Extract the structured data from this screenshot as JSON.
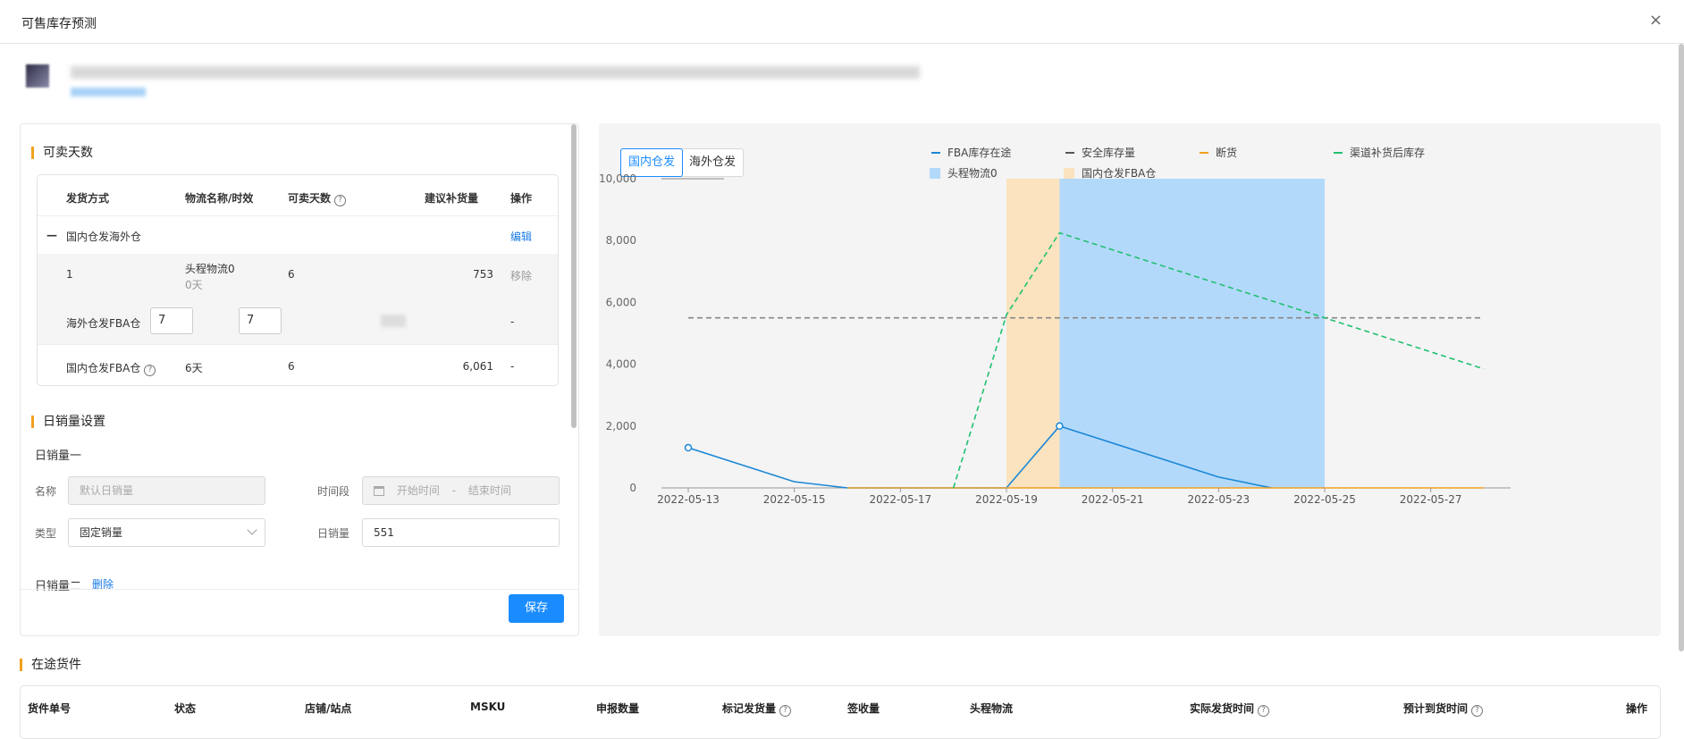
{
  "dialog": {
    "title": "可售库存预测",
    "close_icon": "×"
  },
  "left": {
    "section1_title": "可卖天数",
    "table": {
      "headers": [
        "发货方式",
        "物流名称/时效",
        "可卖天数",
        "建议补货量",
        "操作"
      ],
      "group_label": "国内仓发海外仓",
      "group_action": "编辑",
      "row1": {
        "index": "1",
        "logistics": "头程物流0",
        "logistics_time": "0天",
        "days": "6",
        "qty": "753",
        "action": "移除"
      },
      "row2": {
        "label": "海外仓发FBA仓",
        "input1": "7",
        "input2": "7",
        "action": "-"
      },
      "row3": {
        "label": "国内仓发FBA仓",
        "logistics": "6天",
        "days": "6",
        "qty": "6,061",
        "action": "-"
      }
    },
    "section2_title": "日销量设置",
    "sales1": {
      "title": "日销量一",
      "name_label": "名称",
      "name_placeholder": "默认日销量",
      "period_label": "时间段",
      "start_placeholder": "开始时间",
      "dash": "-",
      "end_placeholder": "结束时间",
      "type_label": "类型",
      "type_value": "固定销量",
      "daily_label": "日销量",
      "daily_value": "551"
    },
    "sales2": {
      "title": "日销量二",
      "delete": "删除"
    },
    "save": "保存"
  },
  "chart_toggle": {
    "domestic": "国内仓发",
    "overseas": "海外仓发"
  },
  "chart_data": {
    "type": "line",
    "x": [
      "2022-05-13",
      "2022-05-14",
      "2022-05-15",
      "2022-05-16",
      "2022-05-17",
      "2022-05-18",
      "2022-05-19",
      "2022-05-20",
      "2022-05-21",
      "2022-05-22",
      "2022-05-23",
      "2022-05-24",
      "2022-05-25",
      "2022-05-26",
      "2022-05-27",
      "2022-05-28"
    ],
    "x_tick_labels": [
      "2022-05-13",
      "2022-05-15",
      "2022-05-17",
      "2022-05-19",
      "2022-05-21",
      "2022-05-23",
      "2022-05-25",
      "2022-05-27"
    ],
    "y_tick_labels": [
      "0",
      "2,000",
      "4,000",
      "6,000",
      "8,000",
      "10,000"
    ],
    "ylim": [
      0,
      10000
    ],
    "series": [
      {
        "name": "FBA库存在途",
        "color": "#1a87d6",
        "style": "solid",
        "points": [
          [
            "2022-05-13",
            1300
          ],
          [
            "2022-05-15",
            200
          ],
          [
            "2022-05-16",
            0
          ],
          [
            "2022-05-19",
            0
          ],
          [
            "2022-05-20",
            2000
          ],
          [
            "2022-05-23",
            350
          ],
          [
            "2022-05-24",
            0
          ]
        ]
      },
      {
        "name": "安全库存量",
        "color": "#888888",
        "style": "dashed",
        "points": [
          [
            "2022-05-13",
            5500
          ],
          [
            "2022-05-28",
            5500
          ]
        ]
      },
      {
        "name": "断货",
        "color": "#f0a020",
        "style": "solid",
        "points": [
          [
            "2022-05-16",
            0
          ],
          [
            "2022-05-28",
            0
          ]
        ]
      },
      {
        "name": "渠道补货后库存",
        "color": "#20c070",
        "style": "dashed",
        "points": [
          [
            "2022-05-18",
            0
          ],
          [
            "2022-05-19",
            5600
          ],
          [
            "2022-05-20",
            8250
          ],
          [
            "2022-05-28",
            3850
          ]
        ]
      }
    ],
    "bands": [
      {
        "name": "头程物流0",
        "color": "#b3d9fa",
        "from": "2022-05-20",
        "to": "2022-05-25"
      },
      {
        "name": "国内仓发FBA仓",
        "color": "#fbe3bf",
        "from": "2022-05-19",
        "to": "2022-05-20"
      }
    ]
  },
  "bottom": {
    "title": "在途货件",
    "headers": [
      "货件单号",
      "状态",
      "店铺/站点",
      "MSKU",
      "申报数量",
      "标记发货量",
      "签收量",
      "头程物流",
      "实际发货时间",
      "预计到货时间",
      "操作"
    ]
  }
}
